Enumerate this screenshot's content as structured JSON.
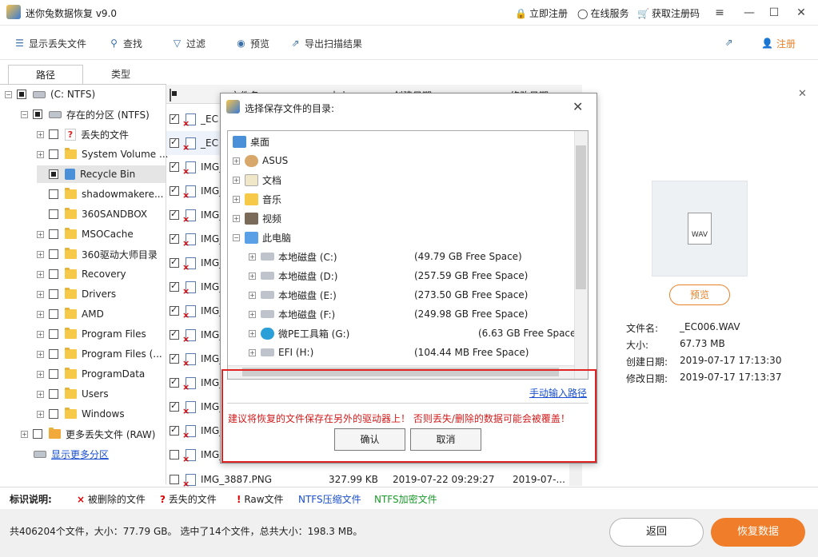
{
  "app": {
    "title": "迷你兔数据恢复 v9.0"
  },
  "title_links": {
    "register": "立即注册",
    "online": "在线服务",
    "code": "获取注册码"
  },
  "toolbar": {
    "show_lost": "显示丢失文件",
    "find": "查找",
    "filter": "过滤",
    "preview": "预览",
    "export": "导出扫描结果",
    "login": "注册"
  },
  "tabs": {
    "path": "路径",
    "type": "类型"
  },
  "tree": {
    "root": "(C: NTFS)",
    "partition": "存在的分区 (NTFS)",
    "items": [
      "丢失的文件",
      "System Volume ...",
      "Recycle Bin",
      "shadowmakere...",
      "360SANDBOX",
      "MSOCache",
      "360驱动大师目录",
      "Recovery",
      "Drivers",
      "AMD",
      "Program Files",
      "Program Files (...",
      "ProgramData",
      "Users",
      "Windows"
    ],
    "raw": "更多丢失文件 (RAW)",
    "more": "显示更多分区"
  },
  "filelist": {
    "headers": [
      "文件名",
      "大小",
      "创建日期",
      "修改日期"
    ],
    "rows": [
      "_EC",
      "_EC",
      "IMG_",
      "IMG_",
      "IMG_",
      "IMG_",
      "IMG_",
      "IMG_",
      "IMG_",
      "IMG_",
      "IMG_",
      "IMG_",
      "IMG_",
      "IMG_",
      "IMG_"
    ],
    "last": {
      "name": "IMG_3887.PNG",
      "size": "327.99 KB",
      "created": "2019-07-22 09:29:27",
      "modified": "2019-07-..."
    }
  },
  "preview": {
    "file_type": "WAV",
    "button": "预览",
    "labels": [
      "文件名:",
      "大小:",
      "创建日期:",
      "修改日期:"
    ],
    "values": [
      "_EC006.WAV",
      "67.73 MB",
      "2019-07-17 17:13:30",
      "2019-07-17 17:13:37"
    ]
  },
  "dialog": {
    "title": "选择保存文件的目录:",
    "desktop": "桌面",
    "folders": [
      "ASUS",
      "文档",
      "音乐",
      "视频"
    ],
    "pc": "此电脑",
    "drives": [
      {
        "name": "本地磁盘 (C:)",
        "free": "(49.79 GB Free Space)"
      },
      {
        "name": "本地磁盘 (D:)",
        "free": "(257.59 GB Free Space)"
      },
      {
        "name": "本地磁盘 (E:)",
        "free": "(273.50 GB Free Space)"
      },
      {
        "name": "本地磁盘 (F:)",
        "free": "(249.98 GB Free Space)"
      },
      {
        "name": "微PE工具箱 (G:)",
        "free": "(6.63 GB Free Space)"
      },
      {
        "name": "EFI (H:)",
        "free": "(104.44 MB Free Space)"
      }
    ],
    "manual": "手动输入路径",
    "warning": "建议将恢复的文件保存在另外的驱动器上！ 否则丢失/删除的数据可能会被覆盖！",
    "ok": "确认",
    "cancel": "取消"
  },
  "legend": {
    "title": "标识说明:",
    "deleted": "被删除的文件",
    "lost": "丢失的文件",
    "raw": "Raw文件",
    "compressed": "NTFS压缩文件",
    "encrypted": "NTFS加密文件"
  },
  "status": {
    "text": "共406204个文件，大小：77.79 GB。 选中了14个文件，总共大小：198.3 MB。",
    "back": "返回",
    "recover": "恢复数据"
  },
  "colors": {
    "accent": "#f07d2a",
    "link": "#1a4fd1",
    "warning": "#d21c1c",
    "compressed": "#1a4fd1",
    "encrypted": "#1a9a2a"
  }
}
